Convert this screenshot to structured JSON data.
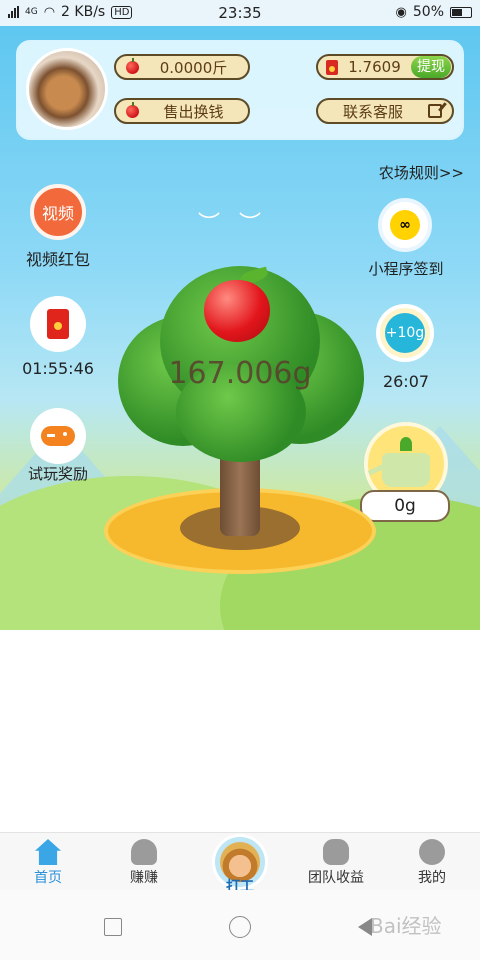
{
  "status": {
    "network_label": "4G",
    "speed": "2 KB/s",
    "hd": "HD",
    "time": "23:35",
    "battery": "50%"
  },
  "profile": {
    "apples_weight": "0.0000斤",
    "sell_label": "售出换钱",
    "cash": "1.7609",
    "withdraw_label": "提现",
    "service_label": "联系客服"
  },
  "rules_link": "农场规则>>",
  "left_actions": {
    "video_icon_text": "视频",
    "video_label": "视频红包",
    "red_packet_timer": "01:55:46",
    "trial_label": "试玩奖励"
  },
  "right_actions": {
    "mini_label": "小程序签到",
    "drop_value": "+10g",
    "drop_timer": "26:07",
    "water_value": "0g"
  },
  "tree": {
    "weight": "167.006g"
  },
  "bottom_nav": [
    {
      "label": "首页",
      "icon": "home-icon",
      "active": true
    },
    {
      "label": "赚赚",
      "icon": "users-icon",
      "active": false
    },
    {
      "label": "打工",
      "icon": "farmer-icon",
      "active": false
    },
    {
      "label": "团队收益",
      "icon": "money-bag-icon",
      "active": false
    },
    {
      "label": "我的",
      "icon": "person-icon",
      "active": false
    }
  ],
  "watermark": "Bai经验",
  "colors": {
    "accent": "#3aa6e6",
    "pill_bg": "#f4e6b8",
    "withdraw": "#4aa82a",
    "video": "#f26a3b"
  }
}
